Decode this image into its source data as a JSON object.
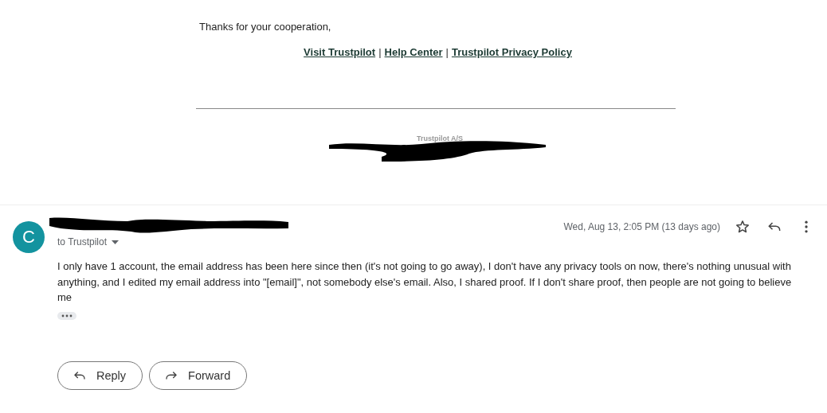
{
  "previous_email": {
    "closing": "Thanks for your cooperation,",
    "links": [
      {
        "label": "Visit Trustpilot"
      },
      {
        "label": "Help Center"
      },
      {
        "label": "Trustpilot Privacy Policy"
      }
    ],
    "link_separator": "|",
    "company": "Trustpilot A/S"
  },
  "message": {
    "avatar_letter": "C",
    "recipient": "to Trustpilot",
    "date": "Wed, Aug 13, 2:05 PM (13 days ago)",
    "starred": false,
    "body": "I only have 1 account, the email address has been here since then (it's not going to go away), I don't have any privacy tools on now, there's nothing unusual with anything, and I edited my email address into \"[email]\", not somebody else's email. Also, I shared proof. If I don't share proof, then people are not going to believe me"
  },
  "actions": [
    {
      "kind": "reply",
      "label": "Reply"
    },
    {
      "kind": "forward",
      "label": "Forward"
    }
  ]
}
